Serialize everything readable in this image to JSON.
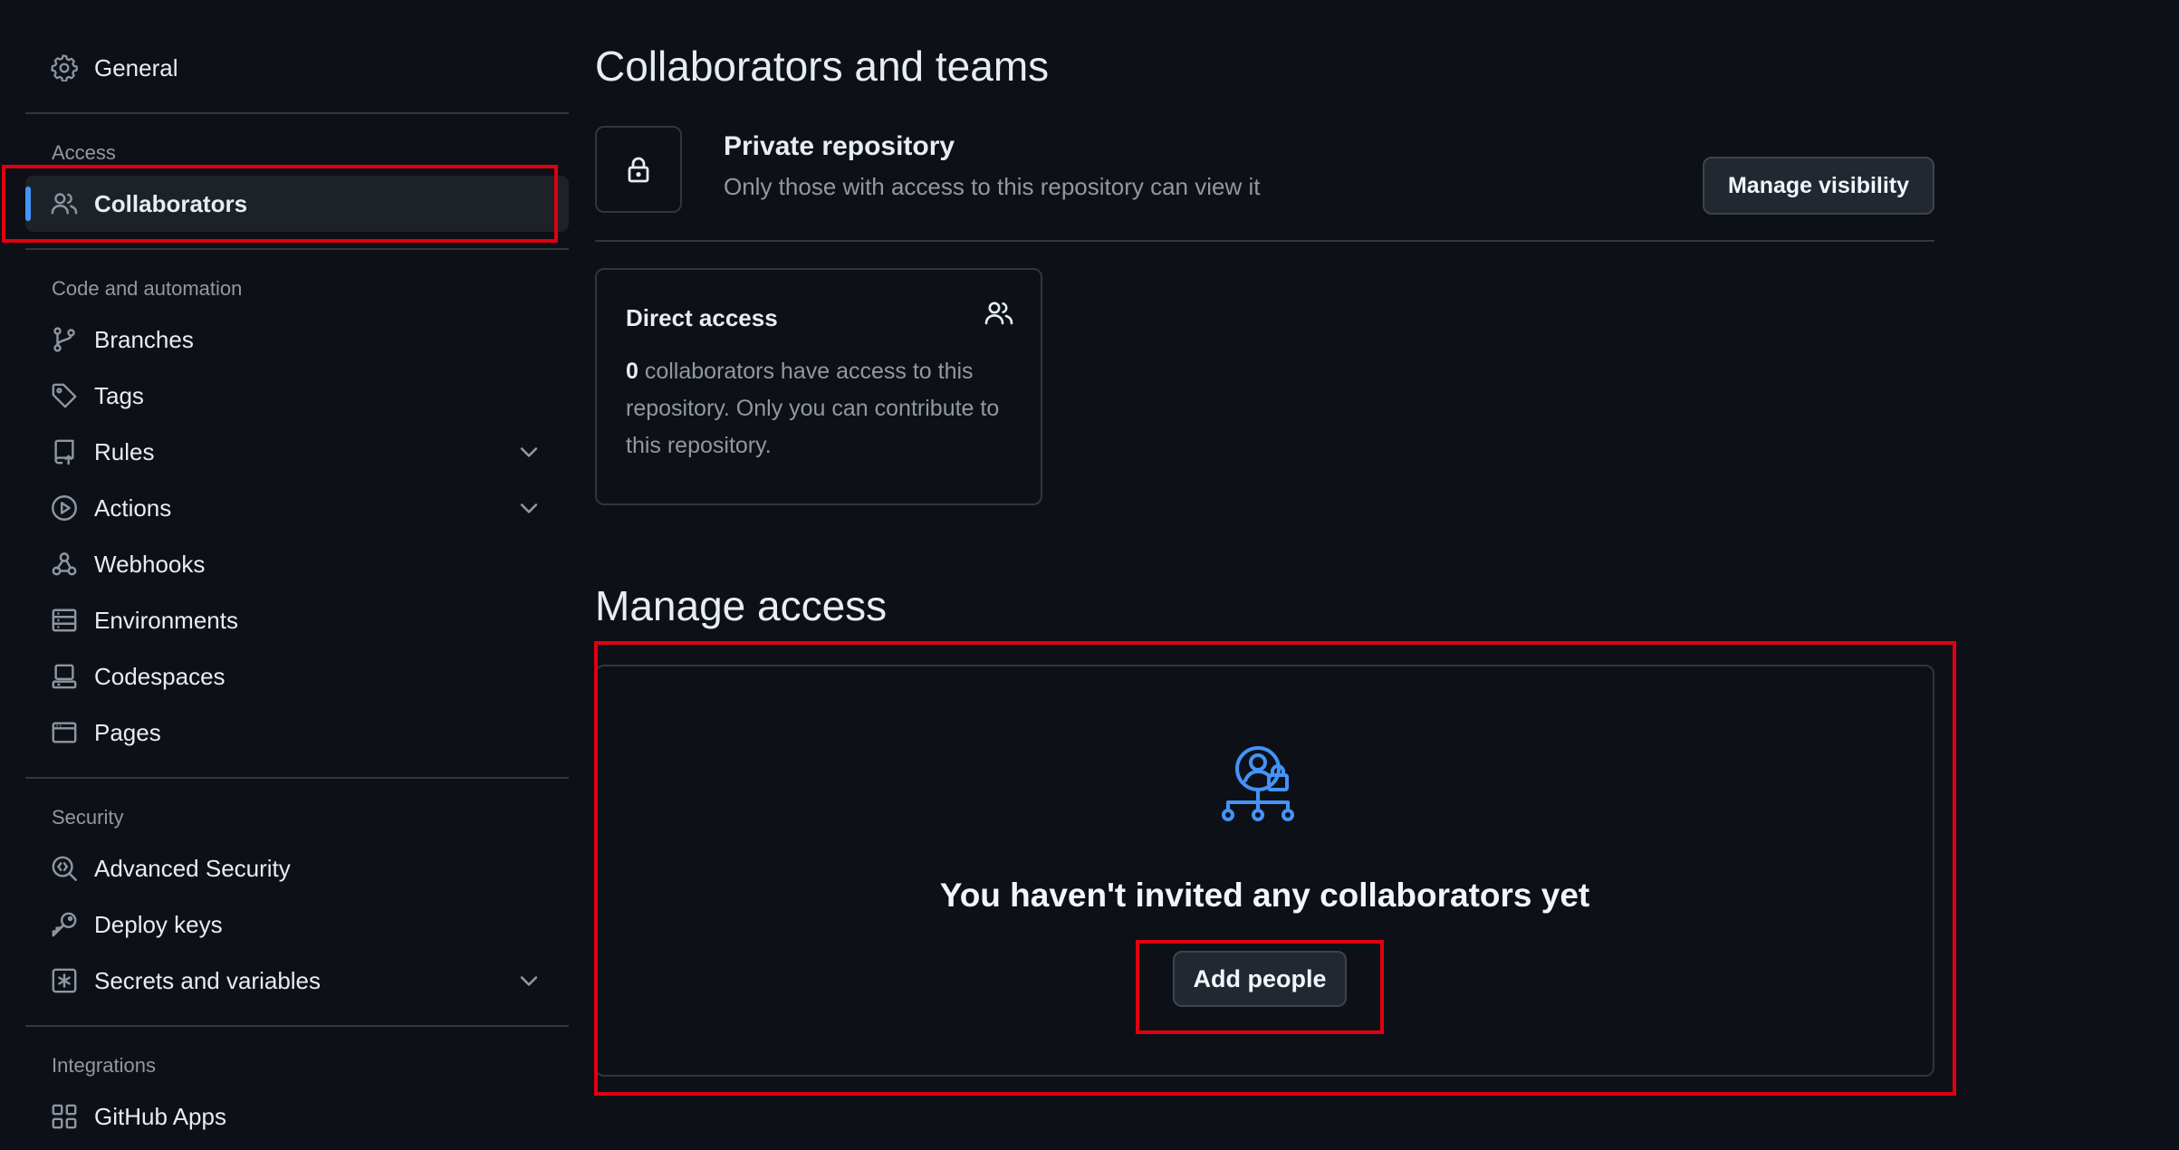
{
  "sidebar": {
    "general": {
      "label": "General",
      "icon": "gear-icon"
    },
    "access_heading": "Access",
    "collaborators": {
      "label": "Collaborators",
      "icon": "people-icon",
      "active": true
    },
    "code_heading": "Code and automation",
    "code_items": [
      {
        "label": "Branches",
        "icon": "git-branch-icon"
      },
      {
        "label": "Tags",
        "icon": "tag-icon"
      },
      {
        "label": "Rules",
        "icon": "repo-push-icon",
        "expandable": true
      },
      {
        "label": "Actions",
        "icon": "play-icon",
        "expandable": true
      },
      {
        "label": "Webhooks",
        "icon": "webhook-icon"
      },
      {
        "label": "Environments",
        "icon": "server-icon"
      },
      {
        "label": "Codespaces",
        "icon": "codespaces-icon"
      },
      {
        "label": "Pages",
        "icon": "browser-icon"
      }
    ],
    "security_heading": "Security",
    "security_items": [
      {
        "label": "Advanced Security",
        "icon": "codescan-icon"
      },
      {
        "label": "Deploy keys",
        "icon": "key-icon"
      },
      {
        "label": "Secrets and variables",
        "icon": "key-asterisk-icon",
        "expandable": true
      }
    ],
    "integrations_heading": "Integrations",
    "integrations_items": [
      {
        "label": "GitHub Apps",
        "icon": "apps-icon"
      }
    ]
  },
  "main": {
    "title": "Collaborators and teams",
    "repo": {
      "title": "Private repository",
      "subtitle": "Only those with access to this repository can view it",
      "manage_button": "Manage visibility",
      "icon": "lock-icon"
    },
    "direct_access": {
      "title": "Direct access",
      "count": "0",
      "text": " collaborators have access to this repository. Only you can contribute to this repository.",
      "icon": "people-icon"
    },
    "manage_access": {
      "title": "Manage access",
      "empty_title": "You haven't invited any collaborators yet",
      "add_button": "Add people",
      "icon": "person-lock-icon"
    }
  },
  "colors": {
    "background": "#0d1117",
    "accent": "#4493f8",
    "highlight": "#e0000f",
    "border": "#30363d"
  }
}
